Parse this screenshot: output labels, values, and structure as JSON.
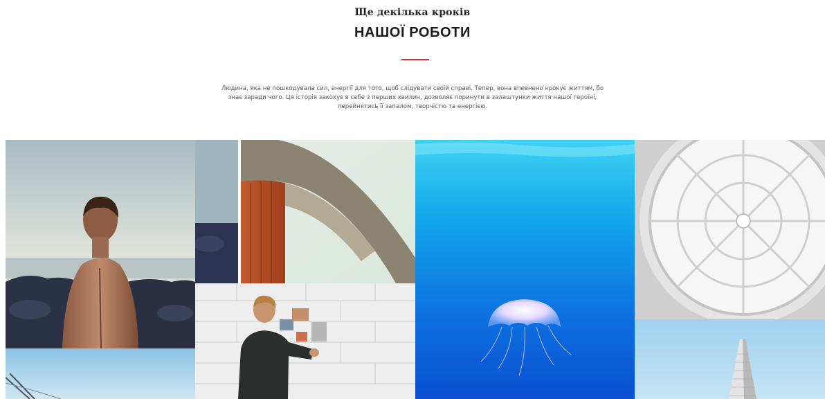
{
  "section": {
    "subtitle": "Ще декілька кроків",
    "title": "НАШОЇ РОБОТИ",
    "accent_color": "#e02b2b",
    "intro_lines": [
      "Людина, яка не пошкодувала сил, енергії для того, щоб слідувати своїй справі. Тепер, вона впевнено крокує життям, бо",
      "знає заради чого. Ця історія закохує в себе з перших хвилин, дозволяє поринути в залаштунки життя нашої героїні,",
      "перейнятись її запалом, творчістю та енергією."
    ]
  },
  "gallery": {
    "tiles": [
      {
        "icon": "man-back-seaside-image"
      },
      {
        "icon": "curved-architecture-image"
      },
      {
        "icon": "man-wall-photos-image"
      },
      {
        "icon": "jellyfish-underwater-image"
      },
      {
        "icon": "glass-dome-ceiling-image"
      },
      {
        "icon": "skyscraper-image"
      },
      {
        "icon": "bridge-sky-image"
      }
    ]
  }
}
